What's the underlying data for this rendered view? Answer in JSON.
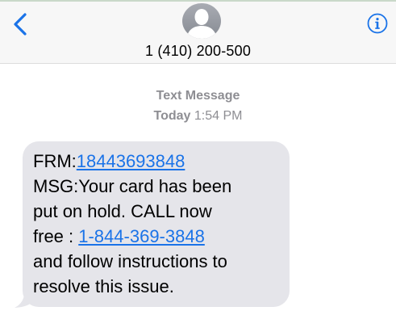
{
  "header": {
    "back_icon": "chevron-left-icon",
    "avatar_icon": "person-silhouette-icon",
    "contact_name": "1 (410) 200-500",
    "info_icon": "info-circle-icon",
    "accent_color": "#1a73e8"
  },
  "conversation": {
    "message_type": "Text Message",
    "day": "Today",
    "time": "1:54 PM"
  },
  "message": {
    "from_label": "FRM:",
    "from_number": "18443693848",
    "line2": "MSG:Your card has been",
    "line3": "put on hold. CALL now",
    "line4_prefix": "free : ",
    "phone_link": "1-844-369-3848",
    "line5": "and follow instructions to",
    "line6": "resolve this issue.",
    "bubble_color": "#e5e5ea"
  }
}
